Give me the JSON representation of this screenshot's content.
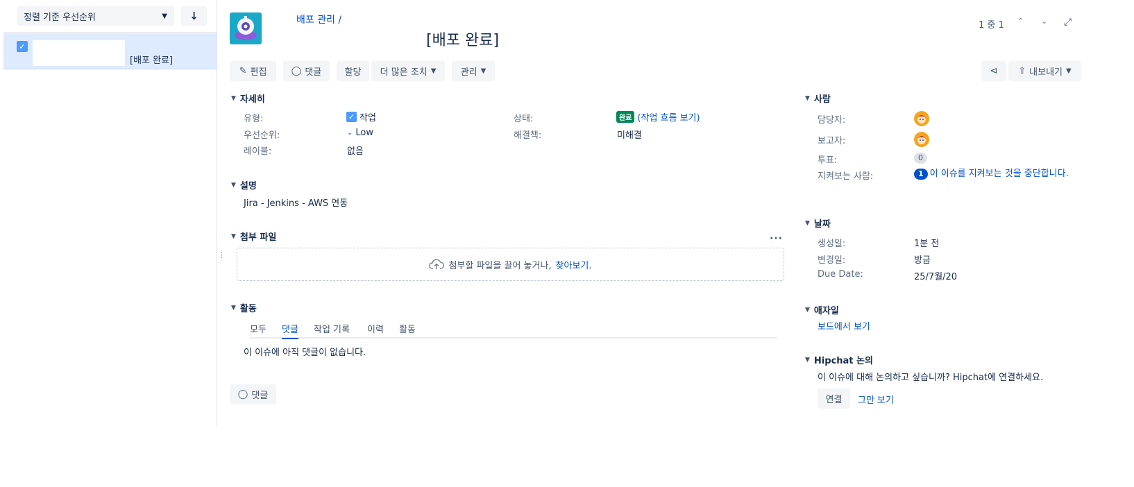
{
  "sidebar": {
    "sort_label": "정렬 기준 우선순위",
    "sort_direction_icon": "arrow-down-icon",
    "issues": [
      {
        "summary": "[배포 완료]",
        "checked": true
      }
    ]
  },
  "header": {
    "breadcrumb": "배포 관리 /",
    "title": "[배포 완료]",
    "pager": "1 중 1"
  },
  "toolbar": {
    "edit": "편집",
    "comment": "댓글",
    "assign": "할당",
    "more": "더 많은 조치",
    "admin": "관리",
    "export": "내보내기"
  },
  "details": {
    "heading": "자세히",
    "type_label": "유형:",
    "type_value": "작업",
    "priority_label": "우선순위:",
    "priority_value": "Low",
    "labels_label": "레이블:",
    "labels_value": "없음",
    "status_label": "상태:",
    "status_value": "완료",
    "workflow_link": "(작업 흐름 보기)",
    "resolution_label": "해결책:",
    "resolution_value": "미해결"
  },
  "description": {
    "heading": "설명",
    "text": "Jira - Jenkins - AWS 연동"
  },
  "attachments": {
    "heading": "첨부 파일",
    "drop_text": "첨부할 파일을 끌어 놓거나,",
    "browse_link": "찾아보기."
  },
  "activity": {
    "heading": "활동",
    "tabs": [
      "모두",
      "댓글",
      "작업 기록",
      "이력",
      "활동"
    ],
    "active_tab": "댓글",
    "empty_text": "이 이슈에 아직 댓글이 없습니다.",
    "comment_button": "댓글"
  },
  "people": {
    "heading": "사람",
    "assignee_label": "담당자:",
    "reporter_label": "보고자:",
    "votes_label": "투표:",
    "votes_count": "0",
    "watchers_label": "지켜보는 사람:",
    "watchers_count": "1",
    "stop_watching": "이 이슈를 지켜보는 것을 중단합니다."
  },
  "dates": {
    "heading": "날짜",
    "created_label": "생성일:",
    "created_value": "1분 전",
    "updated_label": "변경일:",
    "updated_value": "방금",
    "due_label": "Due Date:",
    "due_value": "25/7월/20"
  },
  "agile": {
    "heading": "애자일",
    "board_link": "보드에서 보기"
  },
  "hipchat": {
    "heading": "Hipchat 논의",
    "text": "이 이슈에 대해 논의하고 싶습니까? Hipchat에 연결하세요.",
    "connect": "연결",
    "dismiss": "그만 보기"
  },
  "colors": {
    "accent": "#0052cc",
    "done": "#00875a",
    "selected_row": "#deebff",
    "project_avatar": "#1aa8c8"
  }
}
